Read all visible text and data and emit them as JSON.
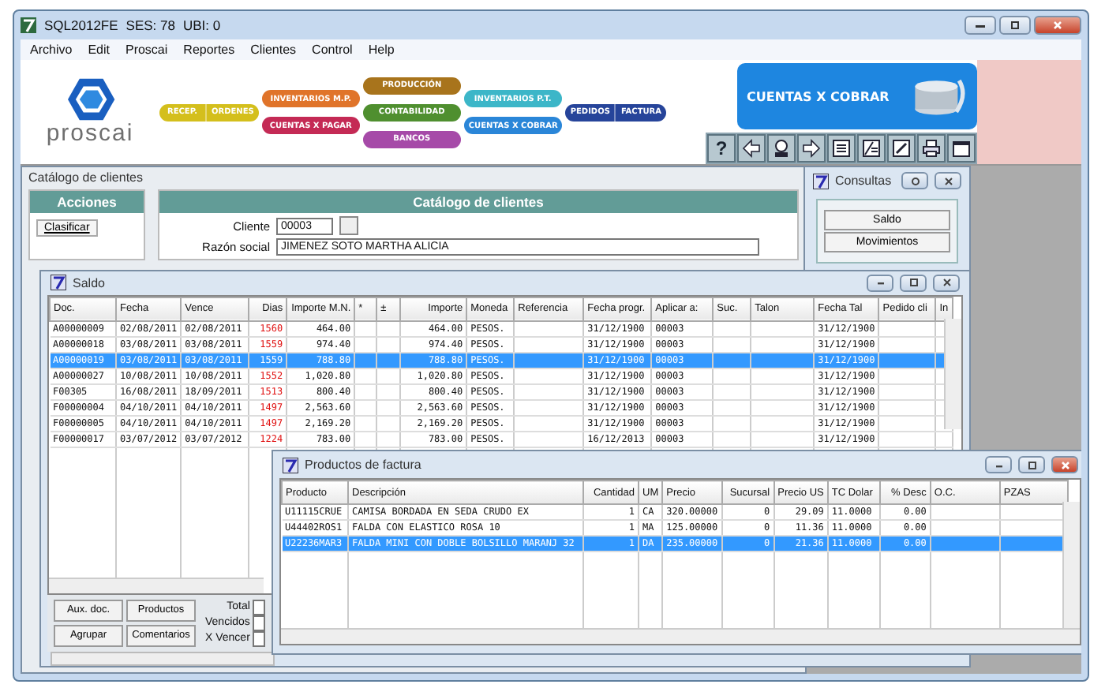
{
  "window": {
    "title_parts": [
      "SQL2012FE",
      "SES: 78",
      "UBI: 0"
    ]
  },
  "menu": [
    "Archivo",
    "Edit",
    "Proscai",
    "Reportes",
    "Clientes",
    "Control",
    "Help"
  ],
  "banner": {
    "logo_text": "proscai",
    "module_columns": [
      [
        {
          "labels": [
            "RECEP.",
            "ORDENES"
          ],
          "color": "#d4bf1c"
        }
      ],
      [
        {
          "labels": [
            "INVENTARIOS M.P."
          ],
          "color": "#e0742a"
        },
        {
          "labels": [
            "CUENTAS X PAGAR"
          ],
          "color": "#c42a55"
        }
      ],
      [
        {
          "labels": [
            "PRODUCCIÓN"
          ],
          "color": "#a8741c"
        },
        {
          "labels": [
            "CONTABILIDAD"
          ],
          "color": "#4f8f2f"
        },
        {
          "labels": [
            "BANCOS"
          ],
          "color": "#a64aa8"
        }
      ],
      [
        {
          "labels": [
            "INVENTARIOS P.T."
          ],
          "color": "#3cb6c8"
        },
        {
          "labels": [
            "CUENTAS X COBRAR"
          ],
          "color": "#2a86d8"
        }
      ],
      [
        {
          "labels": [
            "PEDIDOS",
            "FACTURA"
          ],
          "color": "#26449a"
        }
      ]
    ],
    "module_title": "CUENTAS X COBRAR"
  },
  "toolbar": [
    {
      "kind": "text",
      "label": "?"
    },
    {
      "kind": "back"
    },
    {
      "kind": "person"
    },
    {
      "kind": "forward"
    },
    {
      "kind": "list"
    },
    {
      "kind": "document"
    },
    {
      "kind": "edit"
    },
    {
      "kind": "print"
    },
    {
      "kind": "window"
    }
  ],
  "catalog_window": {
    "title": "Catálogo de clientes",
    "actions_title": "Acciones",
    "actions": [
      "Clasificar"
    ],
    "header": "Catálogo de clientes",
    "fields": [
      {
        "label": "Cliente",
        "value": "00003"
      },
      {
        "label": "Razón social",
        "value": "JIMENEZ SOTO MARTHA ALICIA"
      }
    ]
  },
  "consultas_window": {
    "title": "Consultas",
    "buttons": [
      "Saldo",
      "Movimientos"
    ]
  },
  "saldo_window": {
    "title": "Saldo",
    "columns": [
      "Doc.",
      "Fecha",
      "Vence",
      "Dias",
      "Importe M.N.",
      "*",
      "±",
      "Importe",
      "Moneda",
      "Referencia",
      "Fecha progr.",
      "Aplicar a:",
      "Suc.",
      "Talon",
      "Fecha Tal",
      "Pedido cli",
      "In"
    ],
    "rows": [
      {
        "cells": [
          "A00000009",
          "02/08/2011",
          "02/08/2011",
          "1560",
          "464.00",
          null,
          null,
          "464.00",
          "PESOS.",
          null,
          "31/12/1900",
          "00003",
          null,
          null,
          "31/12/1900",
          null,
          null
        ],
        "selected": false
      },
      {
        "cells": [
          "A00000018",
          "03/08/2011",
          "03/08/2011",
          "1559",
          "974.40",
          null,
          null,
          "974.40",
          "PESOS.",
          null,
          "31/12/1900",
          "00003",
          null,
          null,
          "31/12/1900",
          null,
          null
        ],
        "selected": false
      },
      {
        "cells": [
          "A00000019",
          "03/08/2011",
          "03/08/2011",
          "1559",
          "788.80",
          null,
          null,
          "788.80",
          "PESOS.",
          null,
          "31/12/1900",
          "00003",
          null,
          null,
          "31/12/1900",
          null,
          null
        ],
        "selected": true
      },
      {
        "cells": [
          "A00000027",
          "10/08/2011",
          "10/08/2011",
          "1552",
          "1,020.80",
          null,
          null,
          "1,020.80",
          "PESOS.",
          null,
          "31/12/1900",
          "00003",
          null,
          null,
          "31/12/1900",
          null,
          null
        ],
        "selected": false
      },
      {
        "cells": [
          "F00305",
          "16/08/2011",
          "18/09/2011",
          "1513",
          "800.40",
          null,
          null,
          "800.40",
          "PESOS.",
          null,
          "31/12/1900",
          "00003",
          null,
          null,
          "31/12/1900",
          null,
          null
        ],
        "selected": false
      },
      {
        "cells": [
          "F00000004",
          "04/10/2011",
          "04/10/2011",
          "1497",
          "2,563.60",
          null,
          null,
          "2,563.60",
          "PESOS.",
          null,
          "31/12/1900",
          "00003",
          null,
          null,
          "31/12/1900",
          null,
          null
        ],
        "selected": false
      },
      {
        "cells": [
          "F00000005",
          "04/10/2011",
          "04/10/2011",
          "1497",
          "2,169.20",
          null,
          null,
          "2,169.20",
          "PESOS.",
          null,
          "31/12/1900",
          "00003",
          null,
          null,
          "31/12/1900",
          null,
          null
        ],
        "selected": false
      },
      {
        "cells": [
          "F00000017",
          "03/07/2012",
          "03/07/2012",
          "1224",
          "783.00",
          null,
          null,
          "783.00",
          "PESOS.",
          null,
          "16/12/2013",
          "00003",
          null,
          null,
          "31/12/1900",
          null,
          null
        ],
        "selected": false
      }
    ],
    "buttons": [
      "Aux. doc.",
      "Productos",
      "Agrupar",
      "Comentarios"
    ],
    "totals": [
      "Total",
      "Vencidos",
      "X Vencer"
    ]
  },
  "products_window": {
    "title": "Productos de factura",
    "columns": [
      "Producto",
      "Descripción",
      "Cantidad",
      "UM",
      "Precio",
      "Sucursal",
      "Precio US",
      "TC Dolar",
      "% Desc",
      "O.C.",
      "PZAS"
    ],
    "rows": [
      {
        "cells": [
          "U11115CRUE",
          "CAMISA BORDADA EN SEDA CRUDO EX",
          "1",
          "CA",
          "320.00000",
          "0",
          "29.09",
          "11.0000",
          "0.00",
          null,
          null
        ],
        "selected": false
      },
      {
        "cells": [
          "U44402ROS1",
          "FALDA CON ELASTICO ROSA 10",
          "1",
          "MA",
          "125.00000",
          "0",
          "11.36",
          "11.0000",
          "0.00",
          null,
          null
        ],
        "selected": false
      },
      {
        "cells": [
          "U22236MAR3",
          "FALDA MINI CON DOBLE BOLSILLO MARANJ 32",
          "1",
          "DA",
          "235.00000",
          "0",
          "21.36",
          "11.0000",
          "0.00",
          null,
          null
        ],
        "selected": true
      }
    ]
  }
}
